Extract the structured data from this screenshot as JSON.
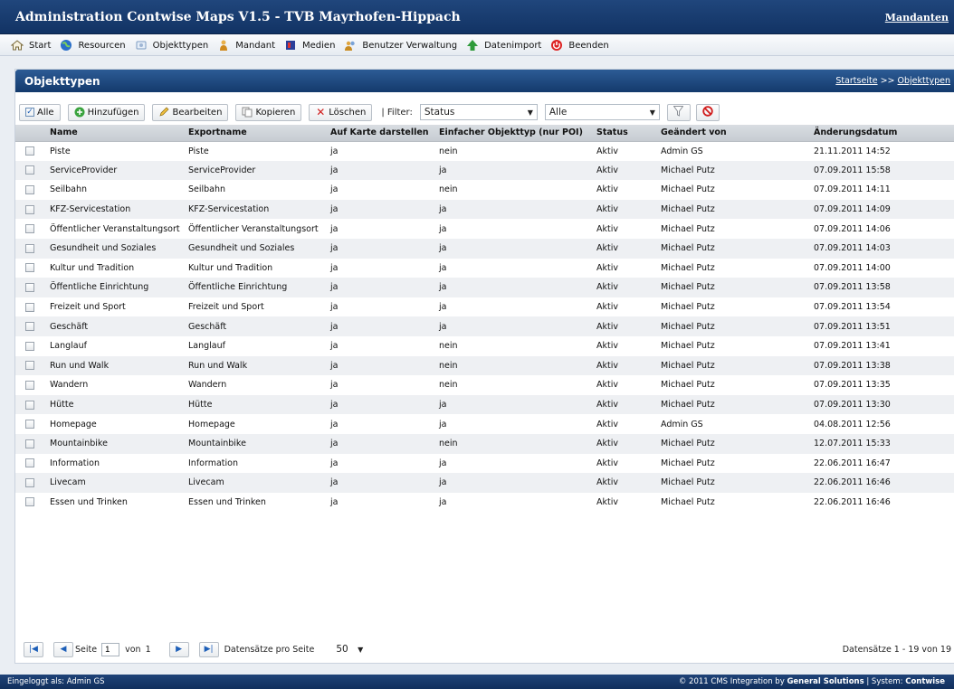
{
  "header": {
    "app_title": "Administration Contwise Maps V1.5 - TVB Mayrhofen-Hippach",
    "mandanten_link": "Mandanten"
  },
  "menu": [
    {
      "label": "Start",
      "icon": "home-icon"
    },
    {
      "label": "Resourcen",
      "icon": "globe-icon"
    },
    {
      "label": "Objekttypen",
      "icon": "objecttypes-icon"
    },
    {
      "label": "Mandant",
      "icon": "user-icon"
    },
    {
      "label": "Medien",
      "icon": "media-icon"
    },
    {
      "label": "Benutzer Verwaltung",
      "icon": "users-icon"
    },
    {
      "label": "Datenimport",
      "icon": "import-icon"
    },
    {
      "label": "Beenden",
      "icon": "power-icon"
    }
  ],
  "panel": {
    "title": "Objekttypen",
    "breadcrumb_home": "Startseite",
    "breadcrumb_sep": ">>",
    "breadcrumb_current": "Objekttypen"
  },
  "toolbar": {
    "all_label": "Alle",
    "add_label": "Hinzufügen",
    "edit_label": "Bearbeiten",
    "copy_label": "Kopieren",
    "delete_label": "Löschen",
    "filter_label": "| Filter:",
    "filter_field": "Status",
    "filter_value": "Alle"
  },
  "table": {
    "columns": [
      "Name",
      "Exportname",
      "Auf Karte darstellen",
      "Einfacher Objekttyp (nur POI)",
      "Status",
      "Geändert von",
      "Änderungsdatum"
    ],
    "rows": [
      [
        "Piste",
        "Piste",
        "ja",
        "nein",
        "Aktiv",
        "Admin GS",
        "21.11.2011 14:52"
      ],
      [
        "ServiceProvider",
        "ServiceProvider",
        "ja",
        "ja",
        "Aktiv",
        "Michael Putz",
        "07.09.2011 15:58"
      ],
      [
        "Seilbahn",
        "Seilbahn",
        "ja",
        "nein",
        "Aktiv",
        "Michael Putz",
        "07.09.2011 14:11"
      ],
      [
        "KFZ-Servicestation",
        "KFZ-Servicestation",
        "ja",
        "ja",
        "Aktiv",
        "Michael Putz",
        "07.09.2011 14:09"
      ],
      [
        "Öffentlicher Veranstaltungsort",
        "Öffentlicher Veranstaltungsort",
        "ja",
        "ja",
        "Aktiv",
        "Michael Putz",
        "07.09.2011 14:06"
      ],
      [
        "Gesundheit und Soziales",
        "Gesundheit und Soziales",
        "ja",
        "ja",
        "Aktiv",
        "Michael Putz",
        "07.09.2011 14:03"
      ],
      [
        "Kultur und Tradition",
        "Kultur und Tradition",
        "ja",
        "ja",
        "Aktiv",
        "Michael Putz",
        "07.09.2011 14:00"
      ],
      [
        "Öffentliche Einrichtung",
        "Öffentliche Einrichtung",
        "ja",
        "ja",
        "Aktiv",
        "Michael Putz",
        "07.09.2011 13:58"
      ],
      [
        "Freizeit und Sport",
        "Freizeit und Sport",
        "ja",
        "ja",
        "Aktiv",
        "Michael Putz",
        "07.09.2011 13:54"
      ],
      [
        "Geschäft",
        "Geschäft",
        "ja",
        "ja",
        "Aktiv",
        "Michael Putz",
        "07.09.2011 13:51"
      ],
      [
        "Langlauf",
        "Langlauf",
        "ja",
        "nein",
        "Aktiv",
        "Michael Putz",
        "07.09.2011 13:41"
      ],
      [
        "Run und Walk",
        "Run und Walk",
        "ja",
        "nein",
        "Aktiv",
        "Michael Putz",
        "07.09.2011 13:38"
      ],
      [
        "Wandern",
        "Wandern",
        "ja",
        "nein",
        "Aktiv",
        "Michael Putz",
        "07.09.2011 13:35"
      ],
      [
        "Hütte",
        "Hütte",
        "ja",
        "ja",
        "Aktiv",
        "Michael Putz",
        "07.09.2011 13:30"
      ],
      [
        "Homepage",
        "Homepage",
        "ja",
        "ja",
        "Aktiv",
        "Admin GS",
        "04.08.2011 12:56"
      ],
      [
        "Mountainbike",
        "Mountainbike",
        "ja",
        "nein",
        "Aktiv",
        "Michael Putz",
        "12.07.2011 15:33"
      ],
      [
        "Information",
        "Information",
        "ja",
        "ja",
        "Aktiv",
        "Michael Putz",
        "22.06.2011 16:47"
      ],
      [
        "Livecam",
        "Livecam",
        "ja",
        "ja",
        "Aktiv",
        "Michael Putz",
        "22.06.2011 16:46"
      ],
      [
        "Essen und Trinken",
        "Essen und Trinken",
        "ja",
        "ja",
        "Aktiv",
        "Michael Putz",
        "22.06.2011 16:46"
      ]
    ]
  },
  "pager": {
    "page_label": "Seite",
    "page_value": "1",
    "of_label": "von",
    "total_pages": "1",
    "per_page_label": "Datensätze pro Seite",
    "per_page_value": "50",
    "record_count": "Datensätze 1 - 19 von 19"
  },
  "footer": {
    "logged_in": "Eingeloggt als: Admin GS",
    "copyright_prefix": "© 2011 CMS Integration by",
    "company": "General Solutions",
    "system_prefix": "| System:",
    "system_name": "Contwise"
  }
}
